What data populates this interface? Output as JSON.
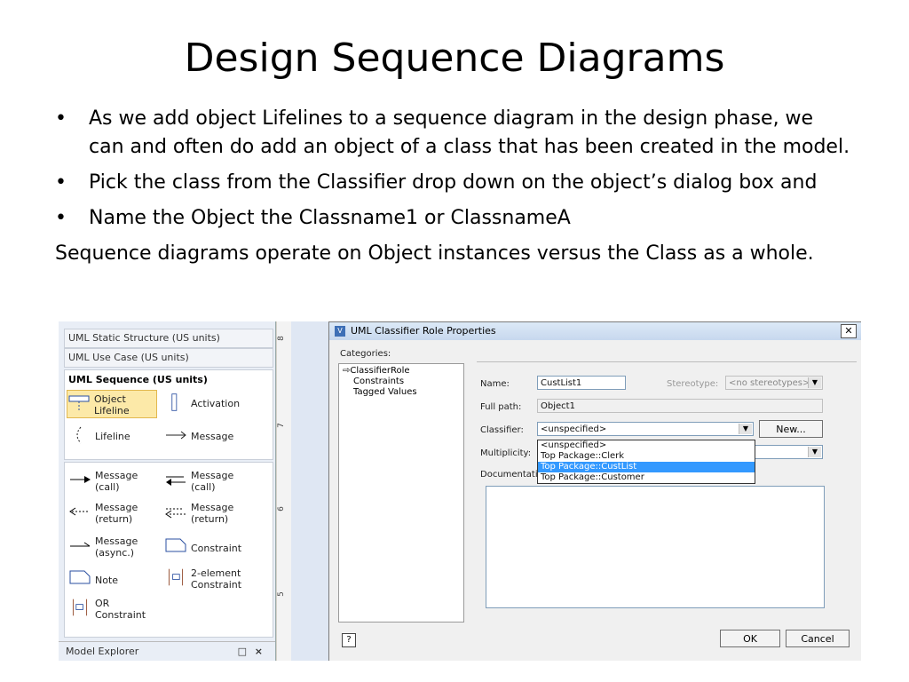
{
  "slide": {
    "title": "Design Sequence Diagrams",
    "bullets": [
      "As we add object Lifelines to a sequence diagram in the design phase, we can and often do add an object of a class that has been created in the model.",
      "Pick the class from the Classifier drop down on the object’s dialog box and",
      "Name the Object the Classname1 or ClassnameA"
    ],
    "paragraph": "Sequence diagrams operate on Object instances versus the Class as a whole."
  },
  "left_panel": {
    "stencils": [
      "UML Static Structure (US units)",
      "UML Use Case (US units)"
    ],
    "sequence_title": "UML Sequence (US units)",
    "shapes": {
      "object_lifeline": "Object\nLifeline",
      "activation": "Activation",
      "lifeline": "Lifeline",
      "message": "Message",
      "message_call_1": "Message\n(call)",
      "message_call_2": "Message\n(call)",
      "message_return_1": "Message\n(return)",
      "message_return_2": "Message\n(return)",
      "message_async": "Message\n(async.)",
      "constraint": "Constraint",
      "note": "Note",
      "two_element_constraint": "2-element\nConstraint",
      "or_constraint": "OR\nConstraint"
    },
    "model_explorer": "Model Explorer"
  },
  "ruler": {
    "marks": [
      "8",
      "7",
      "6",
      "5"
    ]
  },
  "dialog": {
    "title": "UML Classifier Role Properties",
    "close": "✕",
    "categories_label": "Categories:",
    "categories": [
      "ClassifierRole",
      "Constraints",
      "Tagged Values"
    ],
    "name_label": "Name:",
    "name_value": "CustList1",
    "stereotype_label": "Stereotype:",
    "stereotype_value": "<no stereotypes>",
    "fullpath_label": "Full path:",
    "fullpath_value": "Object1",
    "classifier_label": "Classifier:",
    "classifier_value": "<unspecified>",
    "new_button": "New...",
    "multiplicity_label": "Multiplicity:",
    "documentation_label": "Documentation:",
    "classifier_options": [
      "<unspecified>",
      "Top Package::Clerk",
      "Top Package::CustList",
      "Top Package::Customer"
    ],
    "selected_option": "Top Package::CustList",
    "help_button": "?",
    "ok_button": "OK",
    "cancel_button": "Cancel"
  }
}
